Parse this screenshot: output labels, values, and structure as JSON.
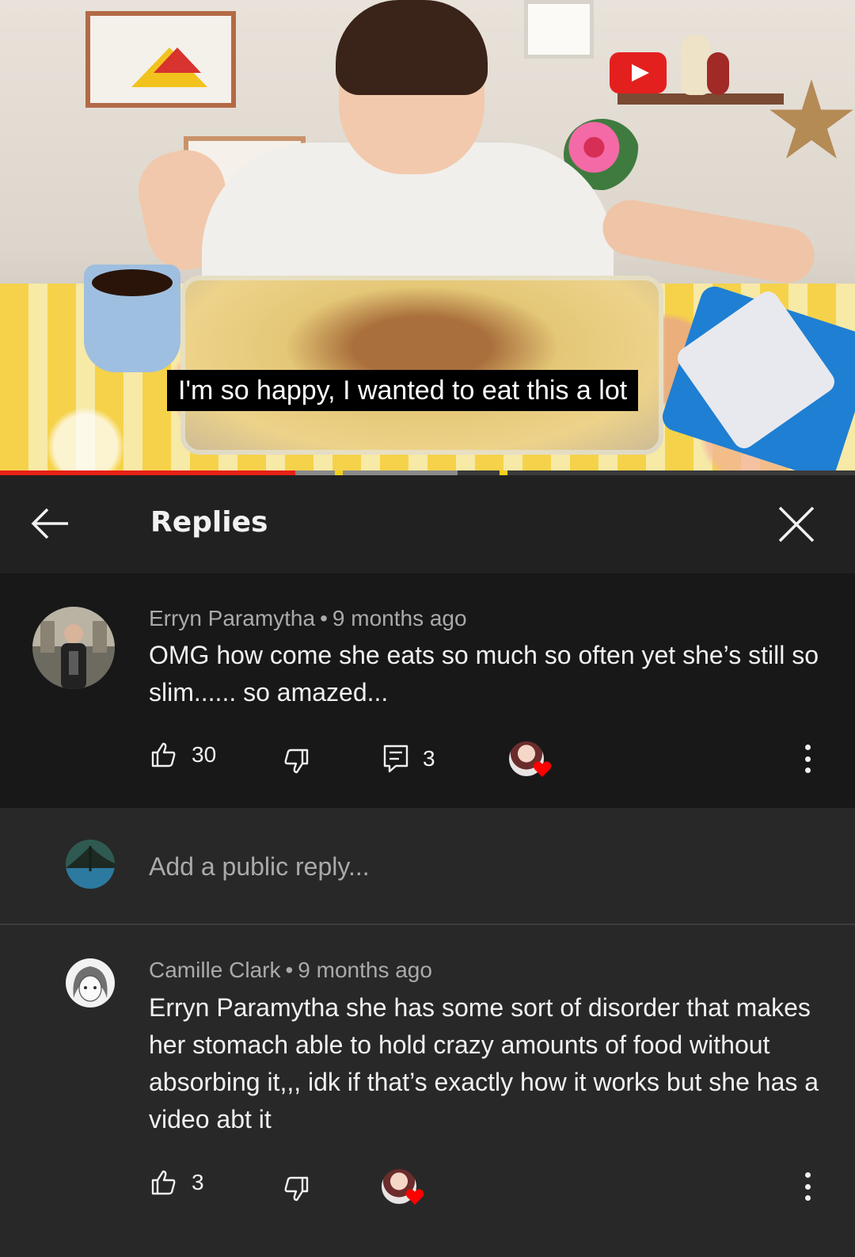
{
  "video": {
    "subtitle": "I'm so happy, I wanted to eat this a lot",
    "progress_played": 0.345,
    "progress_buffered_end": 0.535
  },
  "header": {
    "title": "Replies",
    "back_icon": "arrow-left-icon",
    "close_icon": "close-icon"
  },
  "parent_comment": {
    "author": "Erryn Paramytha",
    "separator": "•",
    "time": "9 months ago",
    "text": "OMG how come she eats so much so often yet she’s still so slim...... so amazed...",
    "likes": "30",
    "replies": "3",
    "creator_heart": true
  },
  "composer": {
    "placeholder": "Add a public reply..."
  },
  "reply": {
    "author": "Camille Clark",
    "separator": "•",
    "time": "9 months ago",
    "text": "Erryn Paramytha she has some sort of disorder that makes her stomach able to hold crazy amounts of food without absorbing it,,, idk if that’s exactly how it works but she has a video abt it",
    "likes": "3",
    "creator_heart": true
  },
  "colors": {
    "background": "#282828",
    "header_bg": "#212121",
    "parent_bg": "#181818",
    "primary_text": "#f1f1f1",
    "secondary_text": "#aaaaaa",
    "progress_red": "#e62117",
    "heart_red": "#ff0000"
  }
}
